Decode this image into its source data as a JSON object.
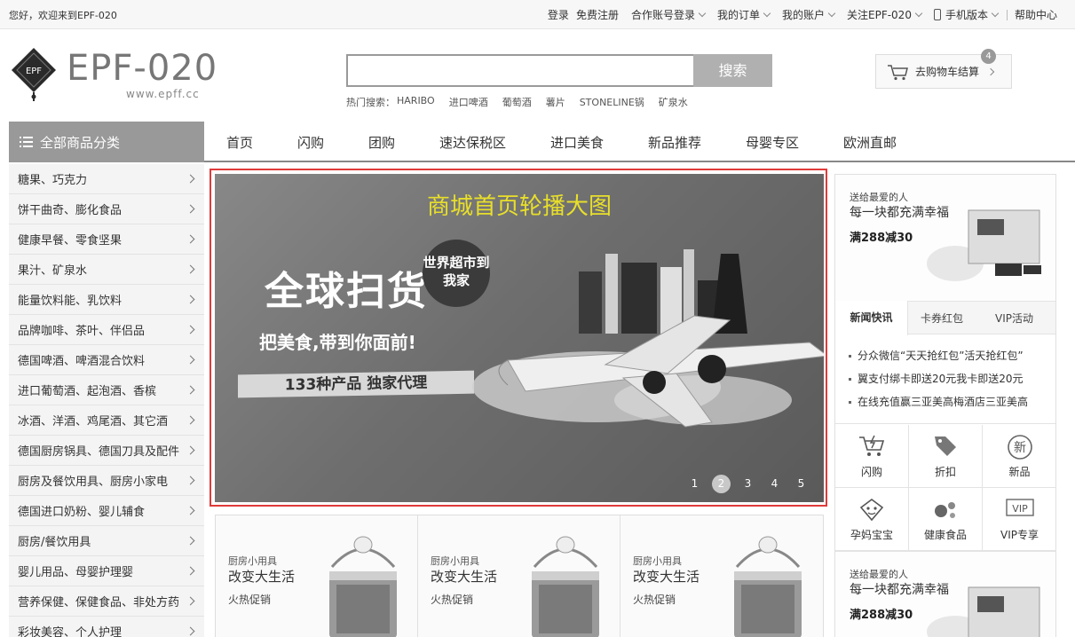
{
  "topbar": {
    "welcome": "您好，欢迎来到EPF-020",
    "login": "登录",
    "register": "免费注册",
    "partner_login": "合作账号登录",
    "my_orders": "我的订单",
    "my_account": "我的账户",
    "follow": "关注EPF-020",
    "mobile": "手机版本",
    "help": "帮助中心"
  },
  "header": {
    "logo_text": "EPF-020",
    "logo_badge": "EPF",
    "logo_sub": "www.epff.cc",
    "search_placeholder": "",
    "search_button": "搜索",
    "hot_label": "热门搜索：",
    "hot_keywords": [
      "HARIBO",
      "进口啤酒",
      "葡萄酒",
      "薯片",
      "STONELINE锅",
      "矿泉水"
    ],
    "cart_label": "去购物车结算",
    "cart_count": "4"
  },
  "nav": {
    "all_categories": "全部商品分类",
    "items": [
      "首页",
      "闪购",
      "团购",
      "速达保税区",
      "进口美食",
      "新品推荐",
      "母婴专区",
      "欧洲直邮"
    ]
  },
  "sidebar": {
    "categories": [
      "糖果、巧克力",
      "饼干曲奇、膨化食品",
      "健康早餐、零食坚果",
      "果汁、矿泉水",
      "能量饮料能、乳饮料",
      "品牌咖啡、茶叶、伴侣品",
      "德国啤酒、啤酒混合饮料",
      "进口葡萄酒、起泡酒、香槟",
      "冰酒、洋酒、鸡尾酒、其它酒",
      "德国厨房锅具、德国刀具及配件",
      "厨房及餐饮用具、厨房小家电",
      "德国进口奶粉、婴儿辅食",
      "厨房/餐饮用具",
      "婴儿用品、母婴护理婴",
      "营养保健、保健食品、非处方药",
      "彩妆美容、个人护理"
    ]
  },
  "banner": {
    "title": "商城首页轮播大图",
    "headline": "全球扫货",
    "stamp": "世界超市到我家",
    "slogan": "把美食,带到你面前!",
    "ribbon": "133种产品 独家代理",
    "pages": [
      "1",
      "2",
      "3",
      "4",
      "5"
    ],
    "active_page": 2
  },
  "products": [
    {
      "tag": "厨房小用具",
      "title": "改变大生活",
      "promo": "火热促销"
    },
    {
      "tag": "厨房小用具",
      "title": "改变大生活",
      "promo": "火热促销"
    },
    {
      "tag": "厨房小用具",
      "title": "改变大生活",
      "promo": "火热促销"
    }
  ],
  "right_panel": {
    "promo_top": {
      "line1": "送给最爱的人",
      "line2": "每一块都充满幸福",
      "line3": "满288减30"
    },
    "tabs": [
      "新闻快讯",
      "卡券红包",
      "VIP活动"
    ],
    "news": [
      "分众微信“天天抢红包”活天抢红包”",
      "翼支付绑卡即送20元我卡即送20元",
      "在线充值赢三亚美高梅酒店三亚美高"
    ],
    "services": [
      {
        "label": "闪购",
        "icon": "cart-flash-icon"
      },
      {
        "label": "折扣",
        "icon": "tag-icon"
      },
      {
        "label": "新品",
        "icon": "new-badge-icon"
      },
      {
        "label": "孕妈宝宝",
        "icon": "baby-face-icon"
      },
      {
        "label": "健康食品",
        "icon": "dots-icon"
      },
      {
        "label": "VIP专享",
        "icon": "vip-icon"
      }
    ],
    "new_glyph": "新",
    "vip_glyph": "VIP",
    "promo_bottom": {
      "line1": "送给最爱的人",
      "line2": "每一块都充满幸福",
      "line3": "满288减30"
    }
  }
}
